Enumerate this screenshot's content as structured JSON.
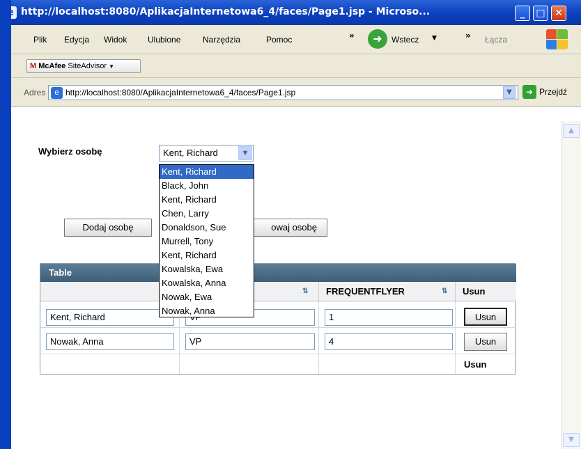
{
  "window": {
    "title": "http://localhost:8080/AplikacjaInternetowa6_4/faces/Page1.jsp - Microso...",
    "minimize": "_",
    "maximize": "□",
    "close": "✕"
  },
  "menu": {
    "items": [
      {
        "label": "Plik"
      },
      {
        "label": "Edycja"
      },
      {
        "label": "Widok"
      },
      {
        "label": "Ulubione"
      },
      {
        "label": "Narzędzia"
      },
      {
        "label": "Pomoc"
      }
    ],
    "chevron1": "»",
    "back_label": "Wstecz",
    "chevron2": "»",
    "links_label": "Łącza"
  },
  "toolbar": {
    "mcafee_brand": "McAfee",
    "mcafee_product": "SiteAdvisor"
  },
  "address": {
    "label": "Adres",
    "url": "http://localhost:8080/AplikacjaInternetowa6_4/faces/Page1.jsp",
    "go_label": "Przejdź"
  },
  "page": {
    "choose_label": "Wybierz osobę",
    "selected_person": "Kent, Richard",
    "add_button": "Dodaj osobę",
    "edit_button_visible": "owaj osobę",
    "dropdown_options": [
      "Kent, Richard",
      "Black, John",
      "Kent, Richard",
      "Chen, Larry",
      "Donaldson, Sue",
      "Murrell, Tony",
      "Kent, Richard",
      "Kowalska, Ewa",
      "Kowalska, Anna",
      "Nowak, Ewa",
      "Nowak, Anna"
    ],
    "table": {
      "title": "Table",
      "columns": [
        "",
        "",
        "FREQUENTFLYER",
        "Usun"
      ],
      "rows": [
        {
          "name": "Kent, Richard",
          "title": "VP",
          "flyer": "1",
          "action": "Usun"
        },
        {
          "name": "Nowak, Anna",
          "title": "VP",
          "flyer": "4",
          "action": "Usun"
        }
      ],
      "footer_action": "Usun"
    }
  },
  "colors": {
    "xp_title_blue": "#0a3fbd",
    "selection_blue": "#316ac5",
    "table_header": "#3d5e78"
  }
}
